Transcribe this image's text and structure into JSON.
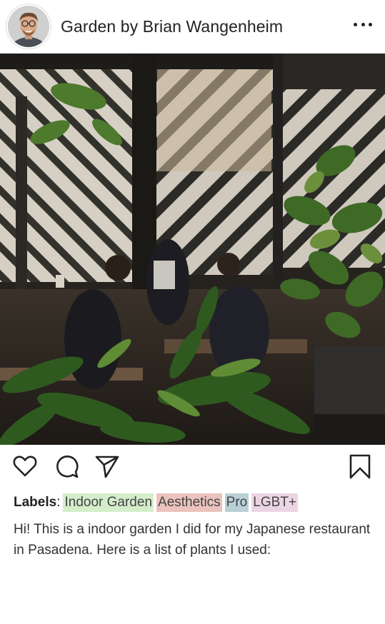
{
  "header": {
    "title": "Garden by Brian Wangenheim",
    "avatar_icon": "user-avatar",
    "more_icon": "ellipsis-icon"
  },
  "photo": {
    "alt": "Indoor garden photo with plants and people seated behind a patterned screen"
  },
  "actions": {
    "like_icon": "heart-icon",
    "comment_icon": "comment-icon",
    "share_icon": "send-icon",
    "save_icon": "bookmark-icon"
  },
  "labels": {
    "heading": "Labels",
    "colon": ":",
    "tags": [
      "Indoor Garden",
      "Aesthetics",
      "Pro",
      "LGBT+"
    ],
    "tag_colors": [
      "#d4eecb",
      "#ebc2bd",
      "#b9d0d7",
      "#ecd5e3"
    ]
  },
  "caption": "Hi! This is a indoor garden I did for my Japanese restaurant in Pasadena. Here is a list of plants I used:"
}
